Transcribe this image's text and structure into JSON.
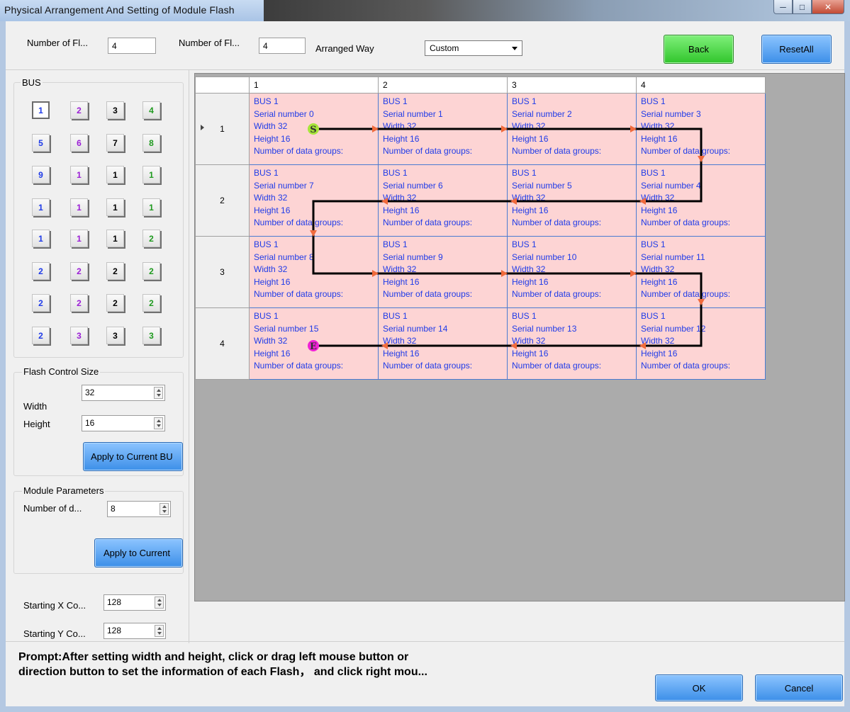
{
  "window": {
    "title": "Physical Arrangement And Setting of Module Flash"
  },
  "top": {
    "num_flash_x_label": "Number of Fl...",
    "num_flash_x_value": "4",
    "num_flash_y_label": "Number of Fl...",
    "num_flash_y_value": "4",
    "arranged_way_label": "Arranged Way",
    "arranged_way_value": "Custom",
    "back_label": "Back",
    "reset_all_label": "ResetAll"
  },
  "bus": {
    "label": "BUS",
    "buttons": [
      {
        "label": "1",
        "color": "#1f3be8"
      },
      {
        "label": "2",
        "color": "#9b1ed6"
      },
      {
        "label": "3",
        "color": "#000000"
      },
      {
        "label": "4",
        "color": "#1f9a1f"
      },
      {
        "label": "5",
        "color": "#1f3be8"
      },
      {
        "label": "6",
        "color": "#9b1ed6"
      },
      {
        "label": "7",
        "color": "#000000"
      },
      {
        "label": "8",
        "color": "#1f9a1f"
      },
      {
        "label": "9",
        "color": "#1f3be8"
      },
      {
        "label": "1",
        "color": "#9b1ed6"
      },
      {
        "label": "1",
        "color": "#000000"
      },
      {
        "label": "1",
        "color": "#1f9a1f"
      },
      {
        "label": "1",
        "color": "#1f3be8"
      },
      {
        "label": "1",
        "color": "#9b1ed6"
      },
      {
        "label": "1",
        "color": "#000000"
      },
      {
        "label": "1",
        "color": "#1f9a1f"
      },
      {
        "label": "1",
        "color": "#1f3be8"
      },
      {
        "label": "1",
        "color": "#9b1ed6"
      },
      {
        "label": "1",
        "color": "#000000"
      },
      {
        "label": "2",
        "color": "#1f9a1f"
      },
      {
        "label": "2",
        "color": "#1f3be8"
      },
      {
        "label": "2",
        "color": "#9b1ed6"
      },
      {
        "label": "2",
        "color": "#000000"
      },
      {
        "label": "2",
        "color": "#1f9a1f"
      },
      {
        "label": "2",
        "color": "#1f3be8"
      },
      {
        "label": "2",
        "color": "#9b1ed6"
      },
      {
        "label": "2",
        "color": "#000000"
      },
      {
        "label": "2",
        "color": "#1f9a1f"
      },
      {
        "label": "2",
        "color": "#1f3be8"
      },
      {
        "label": "3",
        "color": "#9b1ed6"
      },
      {
        "label": "3",
        "color": "#000000"
      },
      {
        "label": "3",
        "color": "#1f9a1f"
      }
    ]
  },
  "flash_control": {
    "label": "Flash Control Size",
    "width_label": "Width",
    "width_value": "32",
    "height_label": "Height",
    "height_value": "16",
    "apply_label": "Apply to Current BU"
  },
  "module_params": {
    "label": "Module Parameters",
    "data_groups_label": "Number of d...",
    "data_groups_value": "8",
    "apply_label": "Apply to Current"
  },
  "start": {
    "x_label": "Starting X Co...",
    "x_value": "128",
    "y_label": "Starting Y Co...",
    "y_value": "128"
  },
  "grid": {
    "columns": [
      "1",
      "2",
      "3",
      "4"
    ],
    "rows": [
      {
        "label": "1",
        "cells": [
          {
            "bus": "BUS 1",
            "serial": "Serial number 0",
            "width": "Width 32",
            "height": "Height 16",
            "groups": "Number of data groups:"
          },
          {
            "bus": "BUS 1",
            "serial": "Serial number 1",
            "width": "Width 32",
            "height": "Height 16",
            "groups": "Number of data groups:"
          },
          {
            "bus": "BUS 1",
            "serial": "Serial number 2",
            "width": "Width 32",
            "height": "Height 16",
            "groups": "Number of data groups:"
          },
          {
            "bus": "BUS 1",
            "serial": "Serial number 3",
            "width": "Width 32",
            "height": "Height 16",
            "groups": "Number of data groups:"
          }
        ]
      },
      {
        "label": "2",
        "cells": [
          {
            "bus": "BUS 1",
            "serial": "Serial number 7",
            "width": "Width 32",
            "height": "Height 16",
            "groups": "Number of data groups:"
          },
          {
            "bus": "BUS 1",
            "serial": "Serial number 6",
            "width": "Width 32",
            "height": "Height 16",
            "groups": "Number of data groups:"
          },
          {
            "bus": "BUS 1",
            "serial": "Serial number 5",
            "width": "Width 32",
            "height": "Height 16",
            "groups": "Number of data groups:"
          },
          {
            "bus": "BUS 1",
            "serial": "Serial number 4",
            "width": "Width 32",
            "height": "Height 16",
            "groups": "Number of data groups:"
          }
        ]
      },
      {
        "label": "3",
        "cells": [
          {
            "bus": "BUS 1",
            "serial": "Serial number 8",
            "width": "Width 32",
            "height": "Height 16",
            "groups": "Number of data groups:"
          },
          {
            "bus": "BUS 1",
            "serial": "Serial number 9",
            "width": "Width 32",
            "height": "Height 16",
            "groups": "Number of data groups:"
          },
          {
            "bus": "BUS 1",
            "serial": "Serial number 10",
            "width": "Width 32",
            "height": "Height 16",
            "groups": "Number of data groups:"
          },
          {
            "bus": "BUS 1",
            "serial": "Serial number 11",
            "width": "Width 32",
            "height": "Height 16",
            "groups": "Number of data groups:"
          }
        ]
      },
      {
        "label": "4",
        "cells": [
          {
            "bus": "BUS 1",
            "serial": "Serial number 15",
            "width": "Width 32",
            "height": "Height 16",
            "groups": "Number of data groups:"
          },
          {
            "bus": "BUS 1",
            "serial": "Serial number 14",
            "width": "Width 32",
            "height": "Height 16",
            "groups": "Number of data groups:"
          },
          {
            "bus": "BUS 1",
            "serial": "Serial number 13",
            "width": "Width 32",
            "height": "Height 16",
            "groups": "Number of data groups:"
          },
          {
            "bus": "BUS 1",
            "serial": "Serial number 12",
            "width": "Width 32",
            "height": "Height 16",
            "groups": "Number of data groups:"
          }
        ]
      }
    ],
    "start_marker": "S",
    "end_marker": "E"
  },
  "bottom": {
    "prompt_line1": "Prompt:After setting width and height, click or drag left mouse button or",
    "prompt_line2": "direction button to set the information of each Flash， and click right mou...",
    "ok_label": "OK",
    "cancel_label": "Cancel"
  },
  "colors": {
    "cell_bg": "#fdd4d4",
    "cell_text": "#1f3be8",
    "path_line": "#000000",
    "arrow": "#f06a3c",
    "start_marker": "#a6e43a",
    "end_marker": "#f021d6"
  }
}
